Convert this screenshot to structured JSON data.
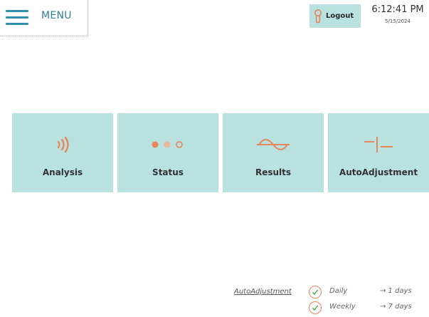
{
  "header": {
    "menu_label": "MENU",
    "logout_label": "Logout",
    "time": "6:12:41 PM",
    "date": "5/15/2024"
  },
  "tiles": [
    {
      "label": "Analysis",
      "icon": "signal-waves-icon"
    },
    {
      "label": "Status",
      "icon": "status-dots-icon"
    },
    {
      "label": "Results",
      "icon": "sine-wave-icon"
    },
    {
      "label": "AutoAdjustment",
      "icon": "adjust-line-icon"
    }
  ],
  "schedule": {
    "link_label": "AutoAdjustment",
    "rows": [
      {
        "frequency": "Daily",
        "interval": "→ 1 days"
      },
      {
        "frequency": "Weekly",
        "interval": "→ 7 days"
      }
    ]
  },
  "colors": {
    "tile_bg": "#b8e1e0",
    "accent_orange": "#e8855a",
    "menu_blue": "#2e8fa8"
  }
}
